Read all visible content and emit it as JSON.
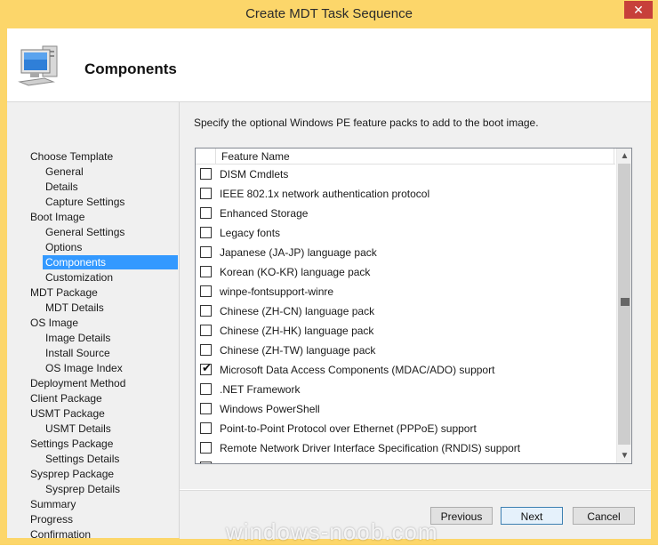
{
  "window": {
    "title": "Create MDT Task Sequence",
    "close_glyph": "✕"
  },
  "header": {
    "title": "Components",
    "icon": "computer-icon"
  },
  "nav": {
    "items": [
      {
        "label": "Choose Template",
        "level": 0
      },
      {
        "label": "General",
        "level": 1
      },
      {
        "label": "Details",
        "level": 1
      },
      {
        "label": "Capture Settings",
        "level": 1
      },
      {
        "label": "Boot Image",
        "level": 0
      },
      {
        "label": "General Settings",
        "level": 1
      },
      {
        "label": "Options",
        "level": 1
      },
      {
        "label": "Components",
        "level": 1,
        "selected": true
      },
      {
        "label": "Customization",
        "level": 1
      },
      {
        "label": "MDT Package",
        "level": 0
      },
      {
        "label": "MDT Details",
        "level": 1
      },
      {
        "label": "OS Image",
        "level": 0
      },
      {
        "label": "Image Details",
        "level": 1
      },
      {
        "label": "Install Source",
        "level": 1
      },
      {
        "label": "OS Image Index",
        "level": 1
      },
      {
        "label": "Deployment Method",
        "level": 0
      },
      {
        "label": "Client Package",
        "level": 0
      },
      {
        "label": "USMT Package",
        "level": 0
      },
      {
        "label": "USMT Details",
        "level": 1
      },
      {
        "label": "Settings Package",
        "level": 0
      },
      {
        "label": "Settings Details",
        "level": 1
      },
      {
        "label": "Sysprep Package",
        "level": 0
      },
      {
        "label": "Sysprep Details",
        "level": 1
      },
      {
        "label": "Summary",
        "level": 0
      },
      {
        "label": "Progress",
        "level": 0
      },
      {
        "label": "Confirmation",
        "level": 0
      }
    ]
  },
  "content": {
    "instruction": "Specify the optional Windows PE feature packs to add to the boot image.",
    "column_header": "Feature Name",
    "features": [
      {
        "label": "DISM Cmdlets",
        "checked": false
      },
      {
        "label": "IEEE 802.1x network authentication protocol",
        "checked": false
      },
      {
        "label": "Enhanced Storage",
        "checked": false
      },
      {
        "label": "Legacy fonts",
        "checked": false
      },
      {
        "label": "Japanese (JA-JP) language pack",
        "checked": false
      },
      {
        "label": "Korean (KO-KR) language pack",
        "checked": false
      },
      {
        "label": "winpe-fontsupport-winre",
        "checked": false
      },
      {
        "label": "Chinese (ZH-CN) language pack",
        "checked": false
      },
      {
        "label": "Chinese (ZH-HK) language pack",
        "checked": false
      },
      {
        "label": "Chinese (ZH-TW) language pack",
        "checked": false
      },
      {
        "label": "Microsoft Data Access Components (MDAC/ADO) support",
        "checked": true
      },
      {
        "label": ".NET Framework",
        "checked": false
      },
      {
        "label": "Windows PowerShell",
        "checked": false
      },
      {
        "label": "Point-to-Point Protocol over Ethernet (PPPoE) support",
        "checked": false
      },
      {
        "label": "Remote Network Driver Interface Specification (RNDIS) support",
        "checked": false
      }
    ]
  },
  "buttons": {
    "previous": "Previous",
    "next": "Next",
    "cancel": "Cancel"
  },
  "watermark": "windows-noob.com",
  "colors": {
    "frame": "#fcd66a",
    "selection": "#3399ff",
    "close": "#c7403a"
  }
}
